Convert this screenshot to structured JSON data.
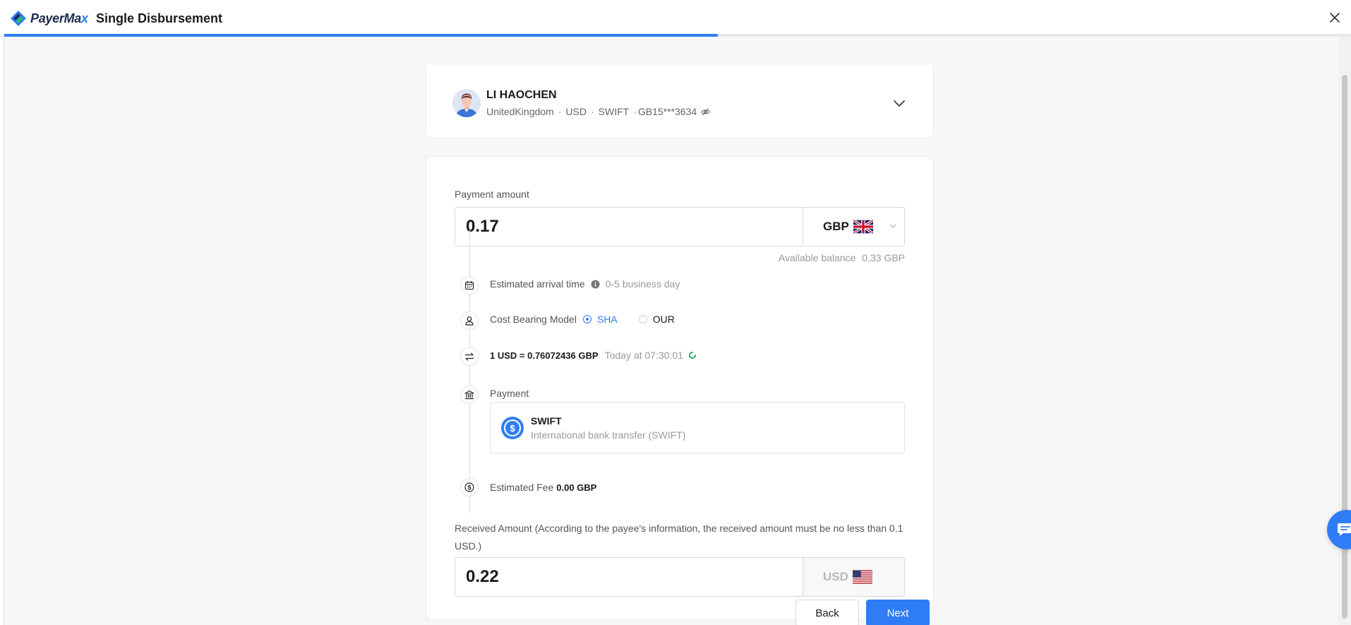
{
  "header": {
    "brand_main": "PayerMa",
    "brand_x": "x",
    "title": "Single Disbursement",
    "progress": 0.53,
    "brand_color": "#2f7df6"
  },
  "payee": {
    "name": "LI HAOCHEN",
    "country": "UnitedKingdom",
    "currency": "USD",
    "method": "SWIFT",
    "account": "GB15***3634"
  },
  "payment_amount": {
    "label": "Payment amount",
    "value": "0.17",
    "currency": "GBP",
    "currency_flag": "uk-flag-icon",
    "balance_label": "Available balance",
    "balance_value": "0.33 GBP"
  },
  "arrival": {
    "label": "Estimated arrival time",
    "value": "0-5 business day"
  },
  "cost_bearing": {
    "label": "Cost Bearing Model",
    "options": [
      {
        "label": "SHA",
        "selected": true
      },
      {
        "label": "OUR",
        "selected": false
      }
    ]
  },
  "rate": {
    "text": "1 USD = 0.76072436 GBP",
    "time": "Today at 07:30:01"
  },
  "payment_method": {
    "label": "Payment",
    "title": "SWIFT",
    "subtitle": "International bank transfer (SWIFT)"
  },
  "fee": {
    "label": "Estimated Fee",
    "value": "0.00 GBP"
  },
  "received": {
    "label": "Received Amount (According to the payee's information, the received amount must be no less than 0.1 USD.)",
    "value": "0.22",
    "currency": "USD",
    "currency_flag": "us-flag-icon"
  },
  "buttons": {
    "back": "Back",
    "next": "Next"
  }
}
